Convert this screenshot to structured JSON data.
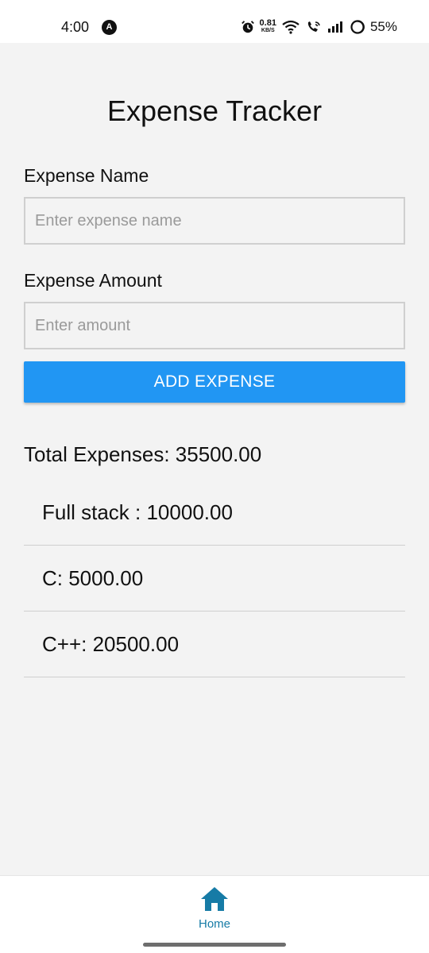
{
  "status_bar": {
    "time": "4:00",
    "app_badge": "A",
    "net_speed_value": "0.81",
    "net_speed_unit": "KB/S",
    "battery_percent": "55%",
    "icons": [
      "alarm-icon",
      "wifi-icon",
      "wifi-calling-icon",
      "signal-icon",
      "battery-icon"
    ]
  },
  "page": {
    "title": "Expense Tracker"
  },
  "form": {
    "name_label": "Expense Name",
    "name_placeholder": "Enter expense name",
    "amount_label": "Expense Amount",
    "amount_placeholder": "Enter amount",
    "add_button": "ADD EXPENSE"
  },
  "summary": {
    "total_text": "Total Expenses: 35500.00"
  },
  "expenses": [
    {
      "text": "Full stack : 10000.00"
    },
    {
      "text": "C: 5000.00"
    },
    {
      "text": "C++: 20500.00"
    }
  ],
  "tab_bar": {
    "home_label": "Home",
    "home_icon": "home-icon",
    "active_color": "#167ba6"
  },
  "colors": {
    "accent": "#2196f3",
    "background": "#f3f3f3"
  }
}
